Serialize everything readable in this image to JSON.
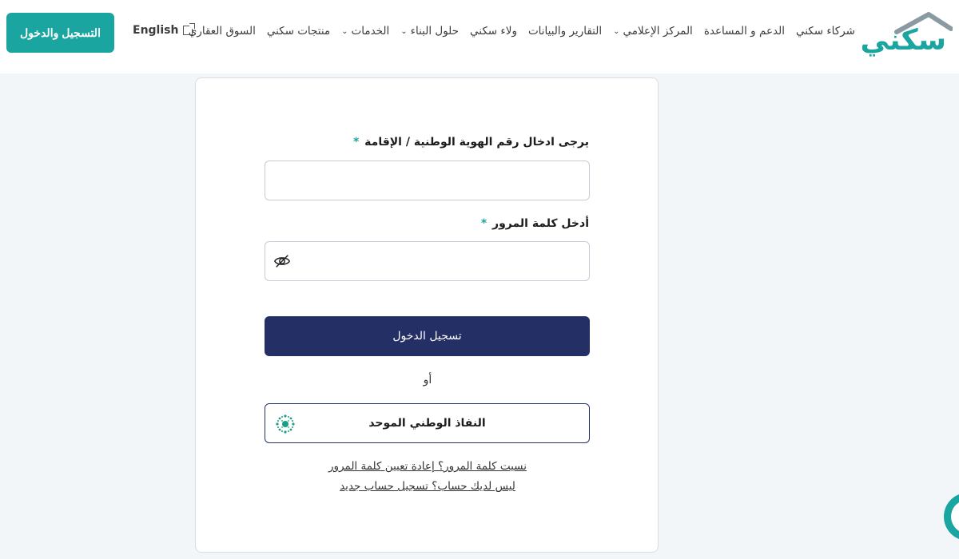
{
  "header": {
    "logo_text": "سكني",
    "nav": [
      {
        "label": "السوق العقاري",
        "has_dropdown": false
      },
      {
        "label": "منتجات سكني",
        "has_dropdown": false
      },
      {
        "label": "الخدمات",
        "has_dropdown": true
      },
      {
        "label": "حلول البناء",
        "has_dropdown": true
      },
      {
        "label": "ولاء سكني",
        "has_dropdown": false
      },
      {
        "label": "التقارير والبيانات",
        "has_dropdown": false
      },
      {
        "label": "المركز الإعلامي",
        "has_dropdown": true
      },
      {
        "label": "الدعم و المساعدة",
        "has_dropdown": false
      },
      {
        "label": "شركاء سكني",
        "has_dropdown": false
      }
    ],
    "language_label": "English",
    "register_label": "التسجيل والدخول"
  },
  "form": {
    "id_label": "يرجى ادخال رقم الهوية الوطنية / الإقامة",
    "id_value": "",
    "password_label": "أدخل كلمة المرور",
    "password_value": "",
    "required_mark": "*",
    "login_label": "تسجيل الدخول",
    "or_text": "أو",
    "nafath_label": "النفاذ الوطني الموحد",
    "forgot_password_link": "نسيت كلمة المرور؟ إعادة تعيين كلمة المرور",
    "no_account_link": "ليس لديك حساب؟ تسجيل حساب جديد"
  },
  "colors": {
    "brand_teal": "#1aa5a0",
    "navy": "#232f65",
    "background": "#f3f6f9"
  },
  "icons": {
    "password_toggle": "eye-off-icon",
    "nafath": "nafath-logo-icon",
    "language": "external-link-icon",
    "dropdown": "chevron-down-icon"
  }
}
